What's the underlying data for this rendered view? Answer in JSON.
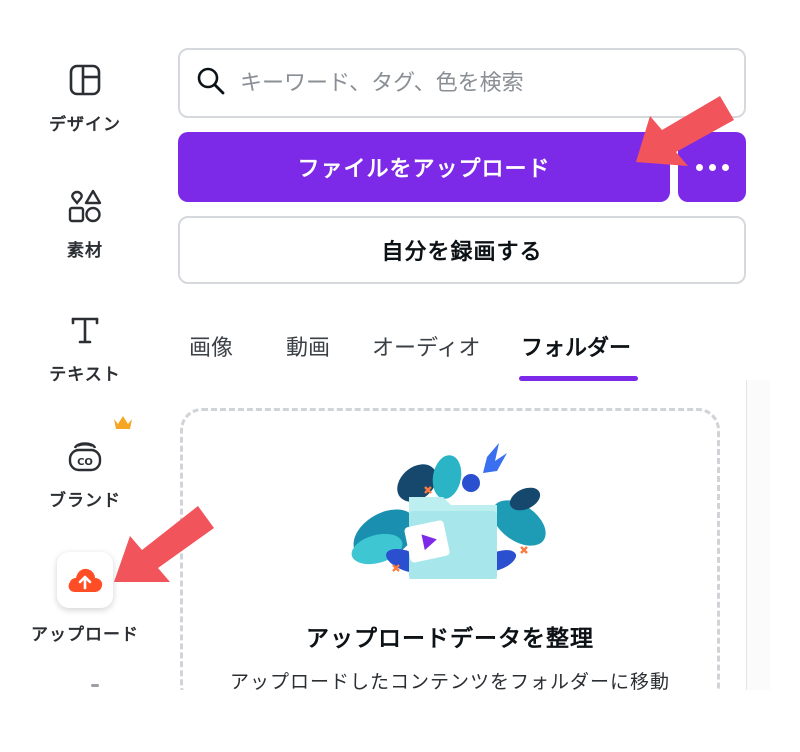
{
  "sidebar": {
    "items": [
      {
        "label": "デザイン",
        "icon": "layout-icon"
      },
      {
        "label": "素材",
        "icon": "shapes-icon"
      },
      {
        "label": "テキスト",
        "icon": "text-icon"
      },
      {
        "label": "ブランド",
        "icon": "brand-icon",
        "badge": "crown-icon"
      },
      {
        "label": "アップロード",
        "icon": "cloud-upload-icon",
        "active": true
      }
    ]
  },
  "search": {
    "placeholder": "キーワード、タグ、色を検索",
    "value": ""
  },
  "actions": {
    "upload_label": "ファイルをアップロード",
    "more_icon": "more-icon",
    "record_label": "自分を録画する"
  },
  "tabs": [
    {
      "label": "画像"
    },
    {
      "label": "動画"
    },
    {
      "label": "オーディオ"
    },
    {
      "label": "フォルダー",
      "active": true
    }
  ],
  "folder_card": {
    "title": "アップロードデータを整理",
    "description": "アップロードしたコンテンツをフォルダーに移動"
  },
  "colors": {
    "accent": "#7d2ae8",
    "upload_icon": "#ff4e26",
    "crown": "#f5a623",
    "annotation_arrow": "#f2545b"
  }
}
